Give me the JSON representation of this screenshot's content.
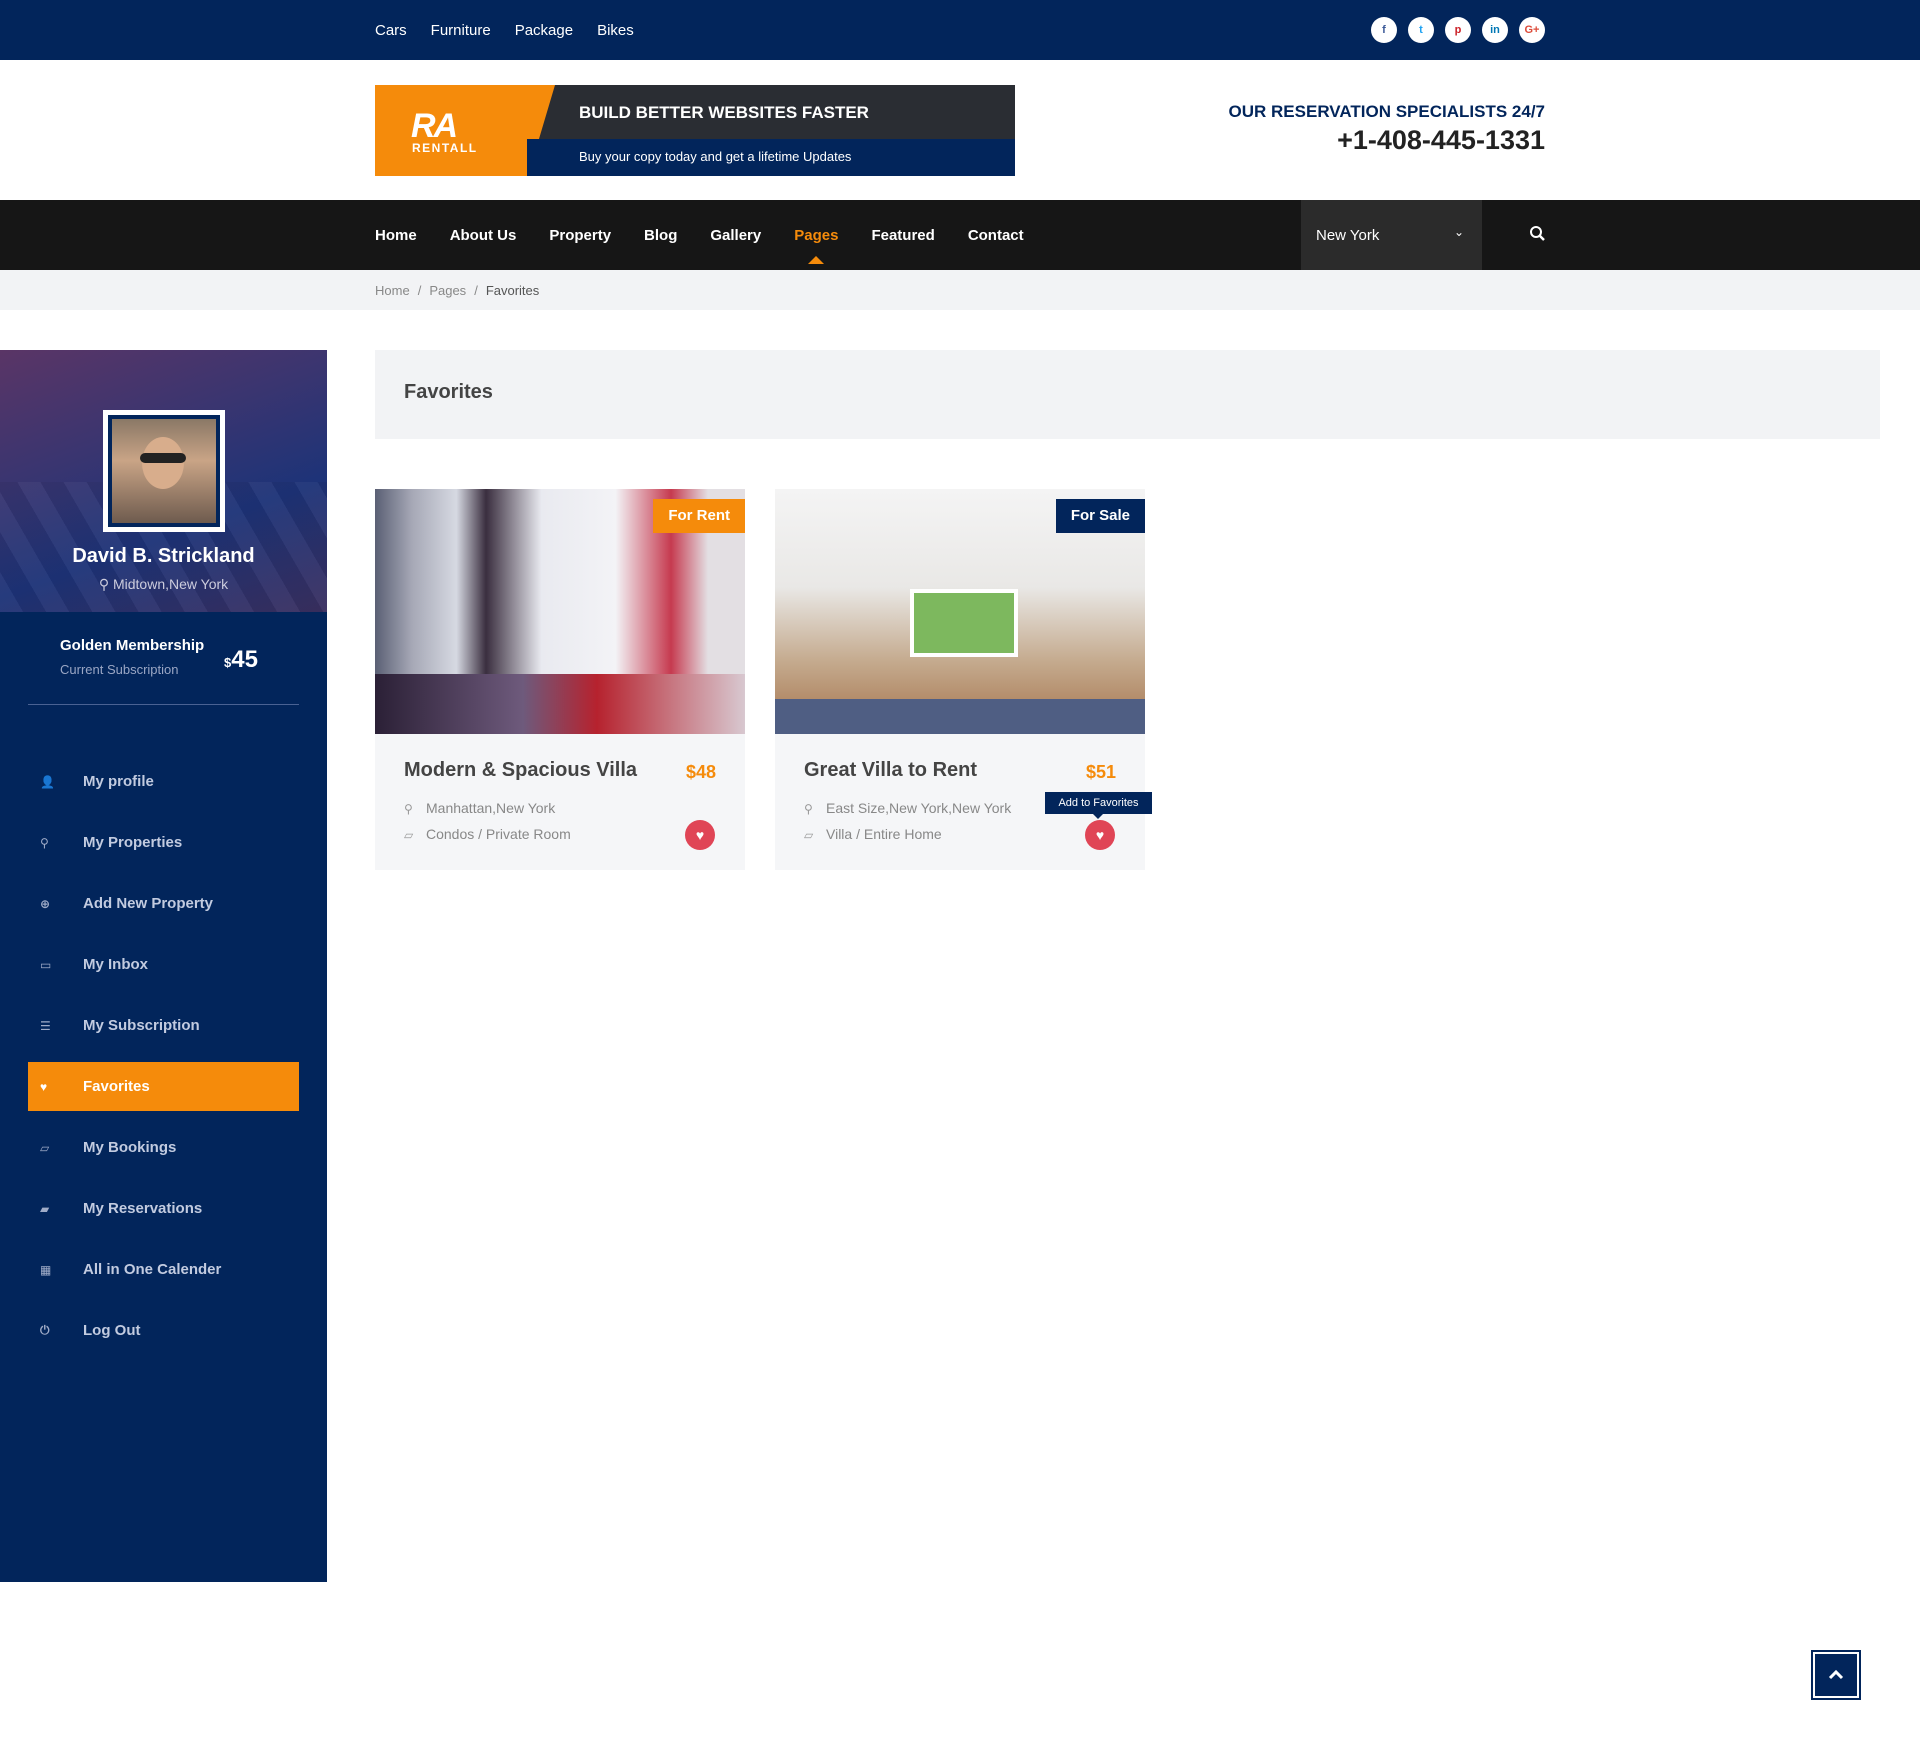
{
  "topbar": {
    "categories": [
      "Cars",
      "Furniture",
      "Package",
      "Bikes"
    ],
    "social": [
      {
        "icon": "facebook-icon",
        "glyph": "f",
        "color": "#3b5998"
      },
      {
        "icon": "twitter-icon",
        "glyph": "t",
        "color": "#1da1f2"
      },
      {
        "icon": "pinterest-icon",
        "glyph": "p",
        "color": "#cb2027"
      },
      {
        "icon": "linkedin-icon",
        "glyph": "in",
        "color": "#0077b5"
      },
      {
        "icon": "google-plus-icon",
        "glyph": "G+",
        "color": "#dd4b39"
      }
    ]
  },
  "header": {
    "logo_mark": "RA",
    "logo_text": "RENTALL",
    "banner_headline": "BUILD BETTER WEBSITES FASTER",
    "banner_sub": "Buy your copy today and get a lifetime Updates",
    "contact_label": "OUR RESERVATION SPECIALISTS 24/7",
    "contact_phone": "+1-408-445-1331"
  },
  "nav": {
    "items": [
      "Home",
      "About Us",
      "Property",
      "Blog",
      "Gallery",
      "Pages",
      "Featured",
      "Contact"
    ],
    "active": "Pages",
    "city": "New York"
  },
  "breadcrumb": {
    "items": [
      "Home",
      "Pages",
      "Favorites"
    ],
    "separator": "/"
  },
  "sidebar": {
    "user_name": "David B. Strickland",
    "user_location": "Midtown,New York",
    "membership": "Golden Membership",
    "subscription_label": "Current Subscription",
    "currency": "$",
    "price": "45",
    "menu": [
      {
        "label": "My profile",
        "icon": "user-icon",
        "glyph": "👤"
      },
      {
        "label": "My Properties",
        "icon": "map-pin-icon",
        "glyph": "⚲"
      },
      {
        "label": "Add New Property",
        "icon": "plus-circle-icon",
        "glyph": "⊕"
      },
      {
        "label": "My Inbox",
        "icon": "inbox-icon",
        "glyph": "▭"
      },
      {
        "label": "My Subscription",
        "icon": "list-icon",
        "glyph": "☰"
      },
      {
        "label": "Favorites",
        "icon": "heart-icon",
        "glyph": "♥"
      },
      {
        "label": "My Bookings",
        "icon": "folder-open-icon",
        "glyph": "▱"
      },
      {
        "label": "My Reservations",
        "icon": "folder-icon",
        "glyph": "▰"
      },
      {
        "label": "All in One Calender",
        "icon": "calendar-icon",
        "glyph": "▦"
      },
      {
        "label": "Log Out",
        "icon": "power-icon",
        "glyph": "⏻"
      }
    ],
    "active": "Favorites"
  },
  "main": {
    "title": "Favorites",
    "cards": [
      {
        "badge": "For Rent",
        "badge_color": "#f58b0b",
        "title": "Modern & Spacious Villa",
        "price": "$48",
        "location": "Manhattan,New York",
        "category": "Condos / Private Room"
      },
      {
        "badge": "For Sale",
        "badge_color": "#02255b",
        "title": "Great Villa to Rent",
        "price": "$51",
        "location": "East Size,New York,New York",
        "category": "Villa / Entire Home"
      }
    ],
    "tooltip": "Add to Favorites"
  },
  "colors": {
    "brand_navy": "#02255b",
    "accent_orange": "#f58b0b",
    "favorite_red": "#e04556"
  }
}
